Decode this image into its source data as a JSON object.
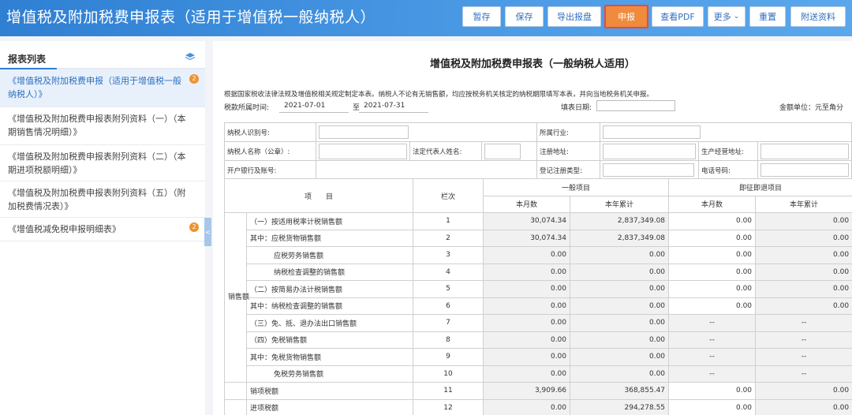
{
  "header": {
    "title": "增值税及附加税费申报表（适用于增值税一般纳税人）",
    "buttons": {
      "temp_save": "暂存",
      "save": "保存",
      "export": "导出报盘",
      "declare": "申报",
      "view_pdf": "查看PDF",
      "more": "更多",
      "reset": "重置",
      "attach": "附送资料"
    }
  },
  "sidebar": {
    "title": "报表列表",
    "items": [
      {
        "label": "《增值税及附加税费申报（适用于增值税一般纳税人）》",
        "badge": "2"
      },
      {
        "label": "《增值税及附加税费申报表附列资料（一）（本期销售情况明细）》",
        "badge": ""
      },
      {
        "label": "《增值税及附加税费申报表附列资料（二）（本期进项税额明细）》",
        "badge": ""
      },
      {
        "label": "《增值税及附加税费申报表附列资料（五）（附加税费情况表）》",
        "badge": ""
      },
      {
        "label": "《增值税减免税申报明细表》",
        "badge": "2"
      }
    ],
    "collapse_glyph": "<"
  },
  "form": {
    "title": "增值税及附加税费申报表（一般纳税人适用）",
    "notice": "根据国家税收法律法规及增值税相关规定制定本表。纳税人不论有无销售额，均应按税务机关核定的纳税期限填写本表，并向当地税务机关申报。",
    "period_label": "税款所属时间:",
    "period_from": "2021-07-01",
    "to_label": "至",
    "period_to": "2021-07-31",
    "fill_date_label": "填表日期:",
    "unit_label": "金额单位：元至角分",
    "info": {
      "taxpayer_id": "纳税人识别号:",
      "industry": "所属行业:",
      "taxpayer_name": "纳税人名称（公章）:",
      "legal_rep": "法定代表人姓名:",
      "reg_address": "注册地址:",
      "biz_address": "生产经营地址:",
      "bank": "开户银行及账号:",
      "reg_type": "登记注册类型:",
      "phone": "电话号码:"
    },
    "columns": {
      "item": "项　　目",
      "line": "栏次",
      "general": "一般项目",
      "refund": "即征即退项目",
      "month": "本月数",
      "ytd": "本年累计"
    },
    "group_sales": "销售额",
    "rows": [
      {
        "label": "（一）按适用税率计税销售额",
        "line": "1",
        "g_month": "30,074.34",
        "g_ytd": "2,837,349.08",
        "r_month": "0.00",
        "r_ytd": "0.00",
        "indent": 1
      },
      {
        "label": "其中：应税货物销售额",
        "line": "2",
        "g_month": "30,074.34",
        "g_ytd": "2,837,349.08",
        "r_month": "0.00",
        "r_ytd": "0.00",
        "indent": 0
      },
      {
        "label": "应税劳务销售额",
        "line": "3",
        "g_month": "0.00",
        "g_ytd": "0.00",
        "r_month": "0.00",
        "r_ytd": "0.00",
        "indent": 2
      },
      {
        "label": "纳税检查调整的销售额",
        "line": "4",
        "g_month": "0.00",
        "g_ytd": "0.00",
        "r_month": "0.00",
        "r_ytd": "0.00",
        "indent": 2
      },
      {
        "label": "（二）按简易办法计税销售额",
        "line": "5",
        "g_month": "0.00",
        "g_ytd": "0.00",
        "r_month": "0.00",
        "r_ytd": "0.00",
        "indent": 1
      },
      {
        "label": "其中：纳税检查调整的销售额",
        "line": "6",
        "g_month": "0.00",
        "g_ytd": "0.00",
        "r_month": "0.00",
        "r_ytd": "0.00",
        "indent": 0
      },
      {
        "label": "（三）免、抵、退办法出口销售额",
        "line": "7",
        "g_month": "0.00",
        "g_ytd": "0.00",
        "r_month": "--",
        "r_ytd": "--",
        "indent": 1
      },
      {
        "label": "（四）免税销售额",
        "line": "8",
        "g_month": "0.00",
        "g_ytd": "0.00",
        "r_month": "--",
        "r_ytd": "--",
        "indent": 1
      },
      {
        "label": "其中：免税货物销售额",
        "line": "9",
        "g_month": "0.00",
        "g_ytd": "0.00",
        "r_month": "--",
        "r_ytd": "--",
        "indent": 0
      },
      {
        "label": "免税劳务销售额",
        "line": "10",
        "g_month": "0.00",
        "g_ytd": "0.00",
        "r_month": "--",
        "r_ytd": "--",
        "indent": 2
      },
      {
        "label": "销项税额",
        "line": "11",
        "g_month": "3,909.66",
        "g_ytd": "368,855.47",
        "r_month": "0.00",
        "r_ytd": "0.00",
        "indent": 0
      },
      {
        "label": "进项税额",
        "line": "12",
        "g_month": "0.00",
        "g_ytd": "294,278.55",
        "r_month": "0.00",
        "r_ytd": "0.00",
        "indent": 0
      }
    ]
  }
}
